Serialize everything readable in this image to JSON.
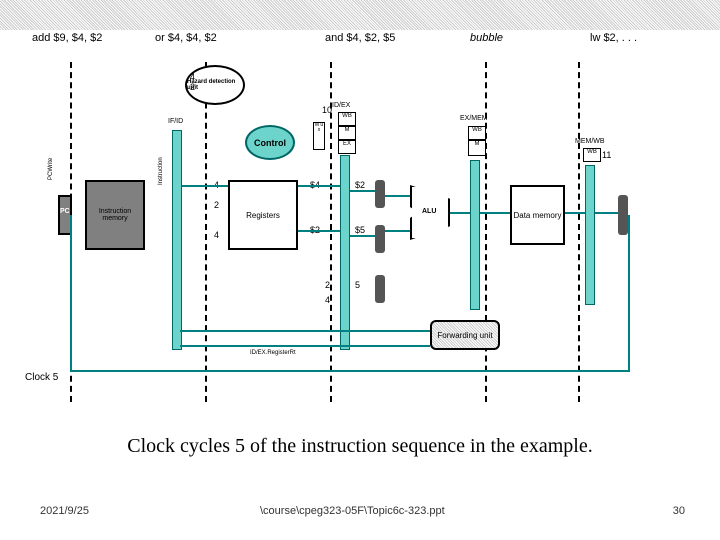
{
  "topbar": {},
  "stages": {
    "s1": "add $9, $4, $2",
    "s2": "or $4, $4, $2",
    "s3": "and $4, $2, $5",
    "s4_italic": "bubble",
    "s5": "lw $2, . . ."
  },
  "pipeline_registers": {
    "if_id": "IF/ID",
    "id_ex": "ID/EX",
    "ex_mem": "EX/MEM",
    "mem_wb": "MEM/WB"
  },
  "control_boxes": {
    "wb1": "WB",
    "m1": "M",
    "ex1": "EX",
    "wb2": "WB",
    "m2": "M",
    "wb3": "WB",
    "mux_label": "M\nu\nx"
  },
  "blocks": {
    "control": "Control",
    "pc": "PC",
    "imem": "Instruction\nmemory",
    "regs": "Registers",
    "alu": "ALU",
    "dmem": "Data\nmemory",
    "fwd": "Forwarding\nunit",
    "hazard": "Hazard\ndetection\nunit",
    "id_ex_shift": "ID/EX.RegisterRt"
  },
  "signals": {
    "pcwrite": "PCWrite",
    "instruction": "Instruction",
    "n10": "10",
    "n11": "11",
    "r4a": "4",
    "r2a": "2",
    "r2b": "2",
    "r4b": "4",
    "val4_a": "$4",
    "val2_a": "$2",
    "val5_a": "$5",
    "two": "2",
    "four": "4",
    "five": "5"
  },
  "clock_label": "Clock 5",
  "caption": "Clock cycles 5 of the instruction sequence in the example.",
  "footer": {
    "date": "2021/9/25",
    "path": "\\course\\cpeg323-05F\\Topic6c-323.ppt",
    "page": "30"
  }
}
